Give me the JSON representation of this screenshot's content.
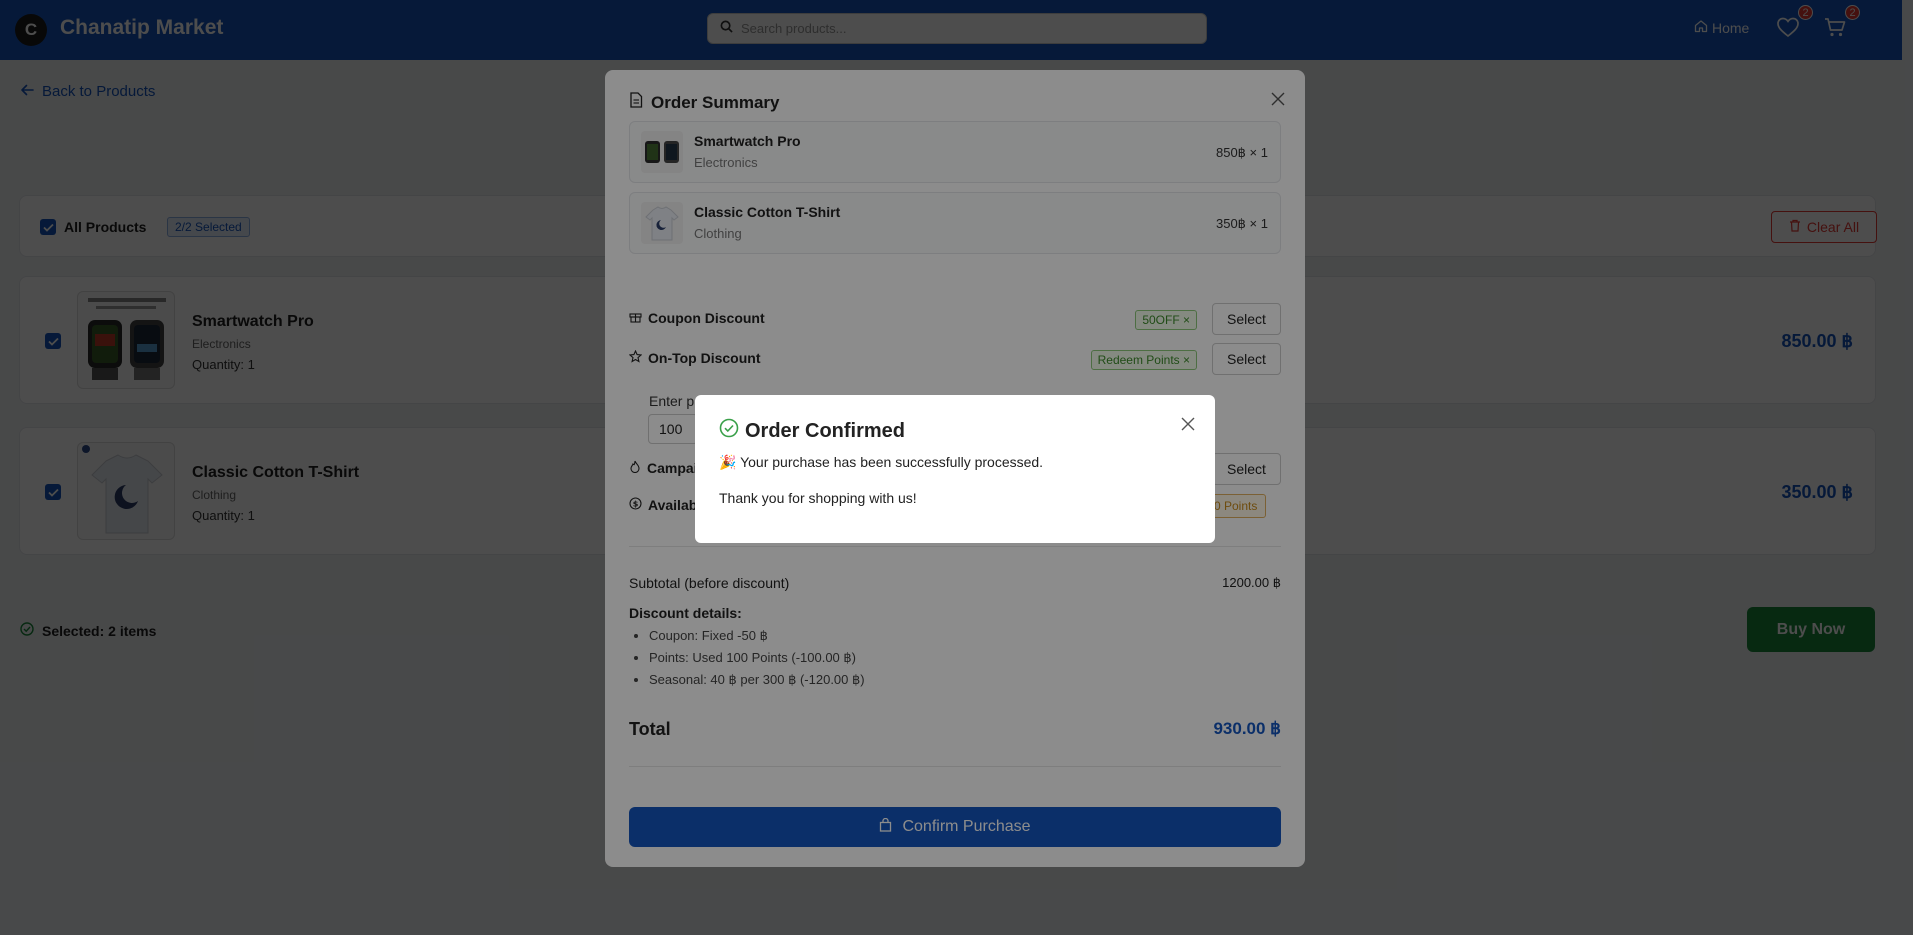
{
  "header": {
    "logo_letter": "C",
    "brand": "Chanatip Market",
    "search_placeholder": "Search products...",
    "home_label": "Home",
    "wishlist_count": "2",
    "cart_count": "2"
  },
  "page": {
    "back_label": "Back to Products",
    "all_products_label": "All Products",
    "selected_tag": "2/2 Selected",
    "clear_all_label": "Clear All",
    "selected_count_label": "Selected: 2 items",
    "buy_now_label": "Buy Now",
    "products": [
      {
        "name": "Smartwatch Pro",
        "category": "Electronics",
        "quantity": "Quantity: 1",
        "price": "850.00 ฿"
      },
      {
        "name": "Classic Cotton T-Shirt",
        "category": "Clothing",
        "quantity": "Quantity: 1",
        "price": "350.00 ฿"
      }
    ]
  },
  "order_summary": {
    "title": "Order Summary",
    "items": [
      {
        "name": "Smartwatch Pro",
        "category": "Electronics",
        "price": "850฿ × 1"
      },
      {
        "name": "Classic Cotton T-Shirt",
        "category": "Clothing",
        "price": "350฿ × 1"
      }
    ],
    "coupon_label": "Coupon Discount",
    "coupon_tag": "50OFF ×",
    "ontop_label": "On-Top Discount",
    "ontop_tag": "Redeem Points ×",
    "select_label": "Select",
    "points_prompt": "Enter p",
    "points_value": "100",
    "campaign_label": "Campai",
    "available_label": "Availab",
    "points_tag": "0 Points",
    "subtotal_label": "Subtotal (before discount)",
    "subtotal_value": "1200.00 ฿",
    "discount_details_label": "Discount details:",
    "discount_lines": [
      "Coupon: Fixed -50 ฿",
      "Points: Used 100 Points (-100.00 ฿)",
      "Seasonal: 40 ฿ per 300 ฿ (-120.00 ฿)"
    ],
    "total_label": "Total",
    "total_value": "930.00 ฿",
    "confirm_label": "Confirm Purchase"
  },
  "dialog": {
    "title": "Order Confirmed",
    "message": "🎉 Your purchase has been successfully processed.",
    "thanks": "Thank you for shopping with us!"
  },
  "colors": {
    "primary": "#1557c0",
    "danger": "#e53935",
    "success": "#1a8a3a"
  }
}
